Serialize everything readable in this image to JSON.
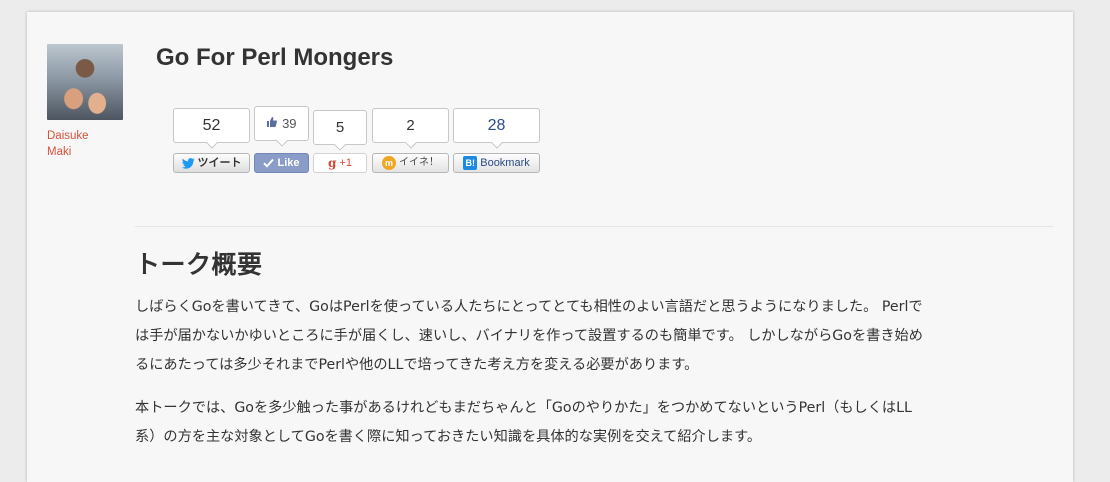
{
  "author": {
    "name_line1": "Daisuke",
    "name_line2": "Maki"
  },
  "page": {
    "title": "Go For Perl Mongers"
  },
  "share": {
    "twitter": {
      "count": "52",
      "label": "ツイート"
    },
    "facebook": {
      "count": "39",
      "label": "Like"
    },
    "googleplus": {
      "count": "5",
      "label": "+1"
    },
    "mixi": {
      "count": "2",
      "label": "イイネ！"
    },
    "hatena": {
      "count": "28",
      "label": "Bookmark"
    }
  },
  "content": {
    "section_title": "トーク概要",
    "paragraph1": {
      "line1": "しばらくGoを書いてきて、GoはPerlを使っている人たちにとってとても相性のよい言語だと思うようになりました。 Perlで",
      "line2": "は手が届かないかゆいところに手が届くし、速いし、バイナリを作って設置するのも簡単です。 しかしながらGoを書き始め",
      "line3": "るにあたっては多少それまでPerlや他のLLで培ってきた考え方を変える必要があります。"
    },
    "paragraph2": {
      "line1": "本トークでは、Goを多少触った事があるけれどもまだちゃんと「Goのやりかた」をつかめてないというPerl（もしくはLL",
      "line2": "系）の方を主な対象としてGoを書く際に知っておきたい知識を具体的な実例を交えて紹介します。"
    }
  }
}
